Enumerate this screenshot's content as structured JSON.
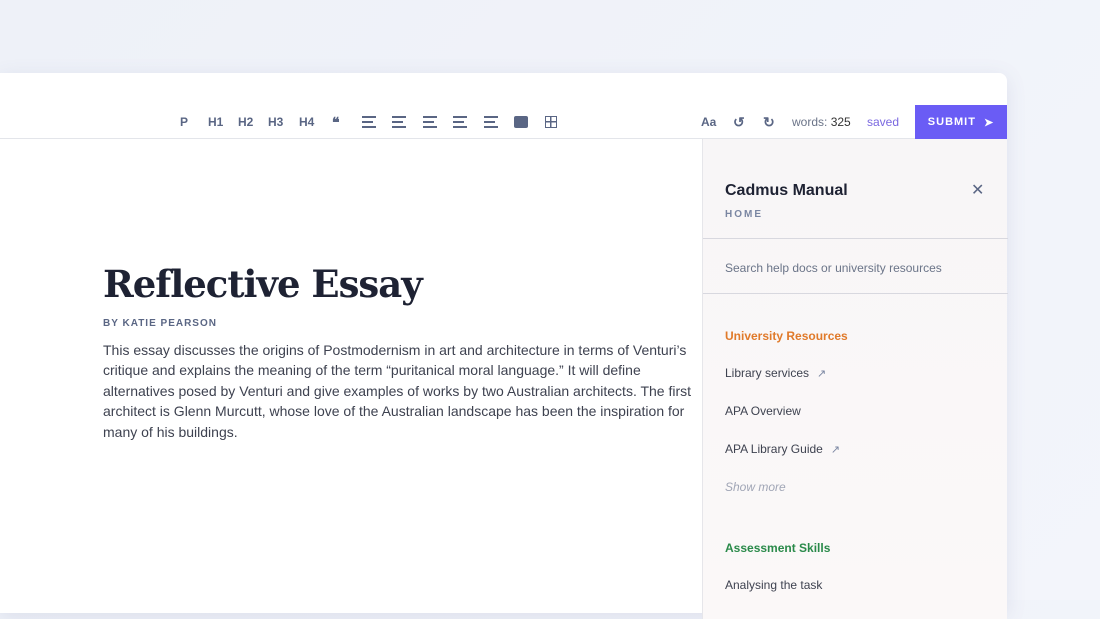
{
  "toolbar": {
    "buttons": [
      "P",
      "H1",
      "H2",
      "H3",
      "H4"
    ],
    "font_label": "Aa",
    "words_label": "words:",
    "words_count": "325",
    "status": "saved",
    "submit": "SUBMIT"
  },
  "document": {
    "title": "Reflective Essay",
    "byline": "BY KATIE PEARSON",
    "body": "This essay discusses the origins of Postmodernism in art and architecture in terms of Venturi’s critique and explains the meaning of the term “puritanical moral language.” It will define alternatives posed by Venturi and give examples of works by two Australian architects. The first architect is Glenn Murcutt, whose love of the Australian landscape has been the inspiration for many of his buildings."
  },
  "sidebar": {
    "title": "Cadmus Manual",
    "breadcrumb": "HOME",
    "search_placeholder": "Search help docs or university resources",
    "sections": [
      {
        "title": "University Resources",
        "color": "#e07a2a",
        "items": [
          "Library services",
          "APA Overview",
          "APA Library Guide"
        ],
        "show_more": "Show more"
      },
      {
        "title": "Assessment Skills",
        "color": "#2a8a4a",
        "items": [
          "Analysing the task"
        ]
      }
    ]
  }
}
